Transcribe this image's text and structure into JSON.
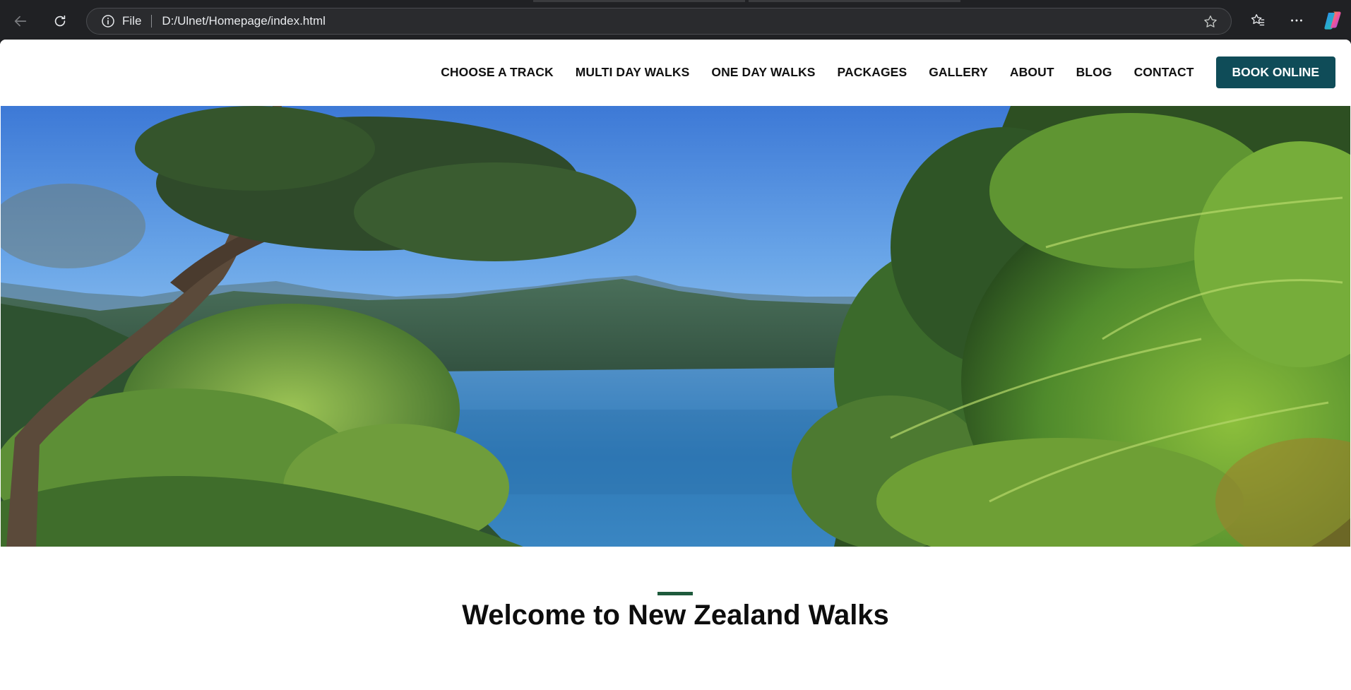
{
  "browser": {
    "scheme_label": "File",
    "url": "D:/Ulnet/Homepage/index.html",
    "icons": {
      "back": "back-arrow-icon",
      "reload": "reload-icon",
      "info": "info-icon",
      "favorite": "star-icon",
      "favorites": "favorites-icon",
      "menu": "more-icon",
      "copilot": "copilot-icon"
    }
  },
  "header": {
    "nav": [
      {
        "label": "CHOOSE A TRACK"
      },
      {
        "label": "MULTI DAY WALKS"
      },
      {
        "label": "ONE DAY WALKS"
      },
      {
        "label": "PACKAGES"
      },
      {
        "label": "GALLERY"
      },
      {
        "label": "ABOUT"
      },
      {
        "label": "BLOG"
      },
      {
        "label": "CONTACT"
      }
    ],
    "cta_label": "BOOK ONLINE",
    "cta_color": "#0f4c58"
  },
  "hero": {
    "description_icon": "landscape-photo"
  },
  "welcome": {
    "title": "Welcome to New Zealand Walks",
    "accent_color": "#1e5a3c"
  }
}
